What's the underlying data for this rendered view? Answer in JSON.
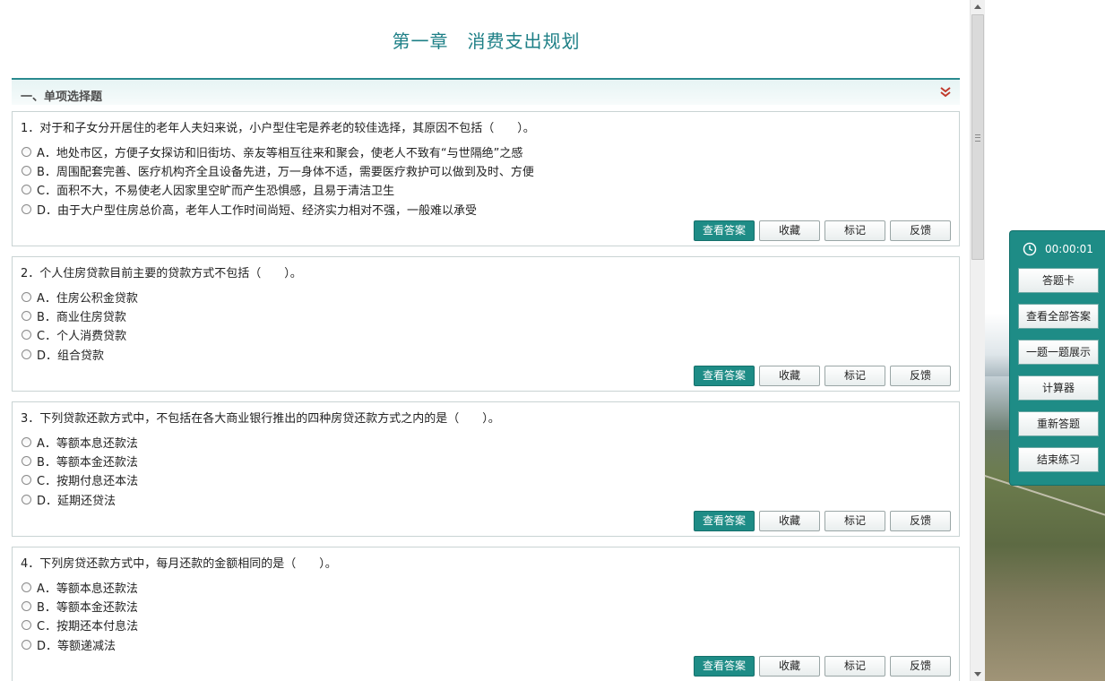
{
  "chapter_title": "第一章　消费支出规划",
  "section": {
    "label": "一、单项选择题"
  },
  "buttons": {
    "view_answer": "查看答案",
    "favorite": "收藏",
    "mark": "标记",
    "feedback": "反馈"
  },
  "questions": [
    {
      "stem": "1．对于和子女分开居住的老年人夫妇来说，小户型住宅是养老的较佳选择，其原因不包括（　　）。",
      "options": [
        "A．地处市区，方便子女探访和旧街坊、亲友等相互往来和聚会，使老人不致有“与世隔绝”之感",
        "B．周围配套完善、医疗机构齐全且设备先进，万一身体不适，需要医疗救护可以做到及时、方便",
        "C．面积不大，不易使老人因家里空旷而产生恐惧感，且易于清洁卫生",
        "D．由于大户型住房总价高，老年人工作时间尚短、经济实力相对不强，一般难以承受"
      ]
    },
    {
      "stem": "2．个人住房贷款目前主要的贷款方式不包括（　　）。",
      "options": [
        "A．住房公积金贷款",
        "B．商业住房贷款",
        "C．个人消费贷款",
        "D．组合贷款"
      ]
    },
    {
      "stem": "3．下列贷款还款方式中，不包括在各大商业银行推出的四种房贷还款方式之内的是（　　）。",
      "options": [
        "A．等额本息还款法",
        "B．等额本金还款法",
        "C．按期付息还本法",
        "D．延期还贷法"
      ]
    },
    {
      "stem": "4．下列房贷还款方式中，每月还款的金额相同的是（　　）。",
      "options": [
        "A．等额本息还款法",
        "B．等额本金还款法",
        "C．按期还本付息法",
        "D．等额递减法"
      ]
    }
  ],
  "side_panel": {
    "timer": "00:00:01",
    "buttons": [
      "答题卡",
      "查看全部答案",
      "一题一题展示",
      "计算器",
      "重新答题",
      "结束练习"
    ]
  },
  "colors": {
    "accent": "#1e8c86",
    "title": "#1d7f86",
    "collapse_icon": "#c0392b"
  }
}
